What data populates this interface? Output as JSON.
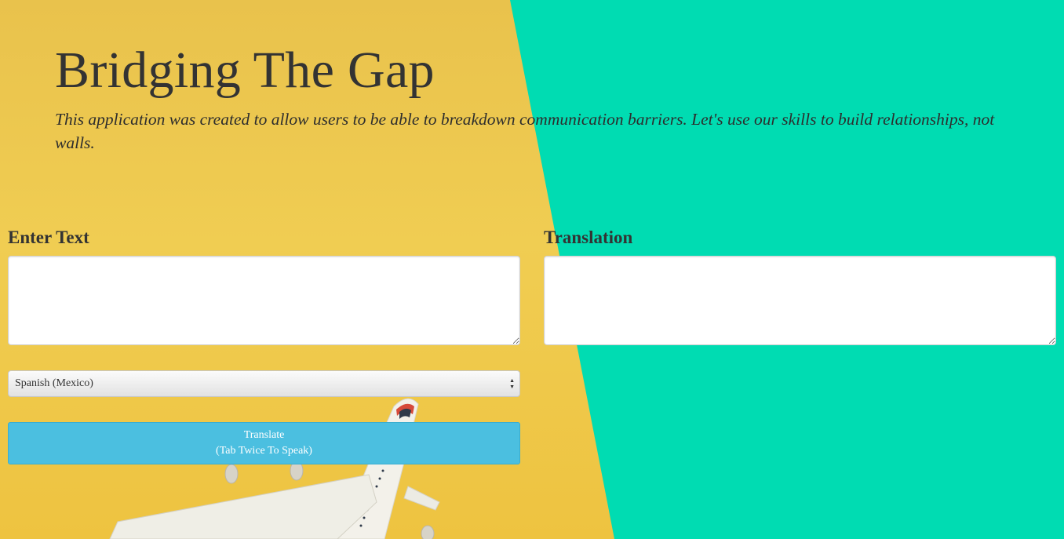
{
  "header": {
    "title": "Bridging The Gap",
    "subtitle": "This application was created to allow users to be able to breakdown communication barriers. Let's use our skills to build relationships, not walls."
  },
  "input_panel": {
    "label": "Enter Text",
    "value": ""
  },
  "output_panel": {
    "label": "Translation",
    "value": ""
  },
  "language_select": {
    "selected": "Spanish (Mexico)"
  },
  "translate_button": {
    "line1": "Translate",
    "line2": "(Tab Twice To Speak)"
  },
  "colors": {
    "left_background": "#ecc64d",
    "right_background": "#00dcb2",
    "button": "#4bbfe0",
    "text": "#333333"
  },
  "background_image": {
    "description_icon": "airplane-toy-icon"
  }
}
